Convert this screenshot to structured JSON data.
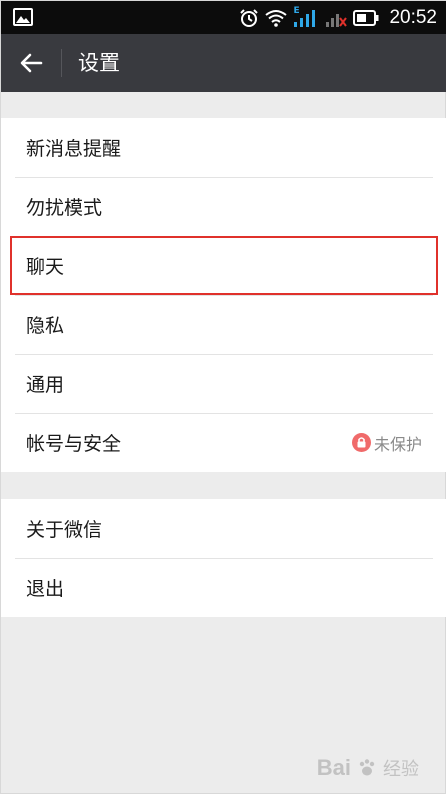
{
  "status_bar": {
    "time": "20:52",
    "network_label": "E",
    "icons": [
      "image-icon",
      "alarm-icon",
      "wifi-icon",
      "signal-icon",
      "signal-no-sim-icon",
      "battery-icon"
    ]
  },
  "title_bar": {
    "title": "设置",
    "back_icon": "back-arrow-icon"
  },
  "group_1": {
    "items": [
      {
        "label": "新消息提醒"
      },
      {
        "label": "勿扰模式"
      },
      {
        "label": "聊天",
        "highlighted": true
      },
      {
        "label": "隐私"
      },
      {
        "label": "通用"
      },
      {
        "label": "帐号与安全",
        "status": "未保护",
        "status_icon": "lock-icon"
      }
    ]
  },
  "group_2": {
    "items": [
      {
        "label": "关于微信"
      },
      {
        "label": "退出"
      }
    ]
  },
  "watermark": {
    "brand": "Bai",
    "sub": "经验"
  },
  "colors": {
    "status_bar": "#0c0c0c",
    "title_bar": "#393a3f",
    "background": "#ececec",
    "highlight_border": "#e0312b",
    "lock_badge": "#f06a6a"
  }
}
